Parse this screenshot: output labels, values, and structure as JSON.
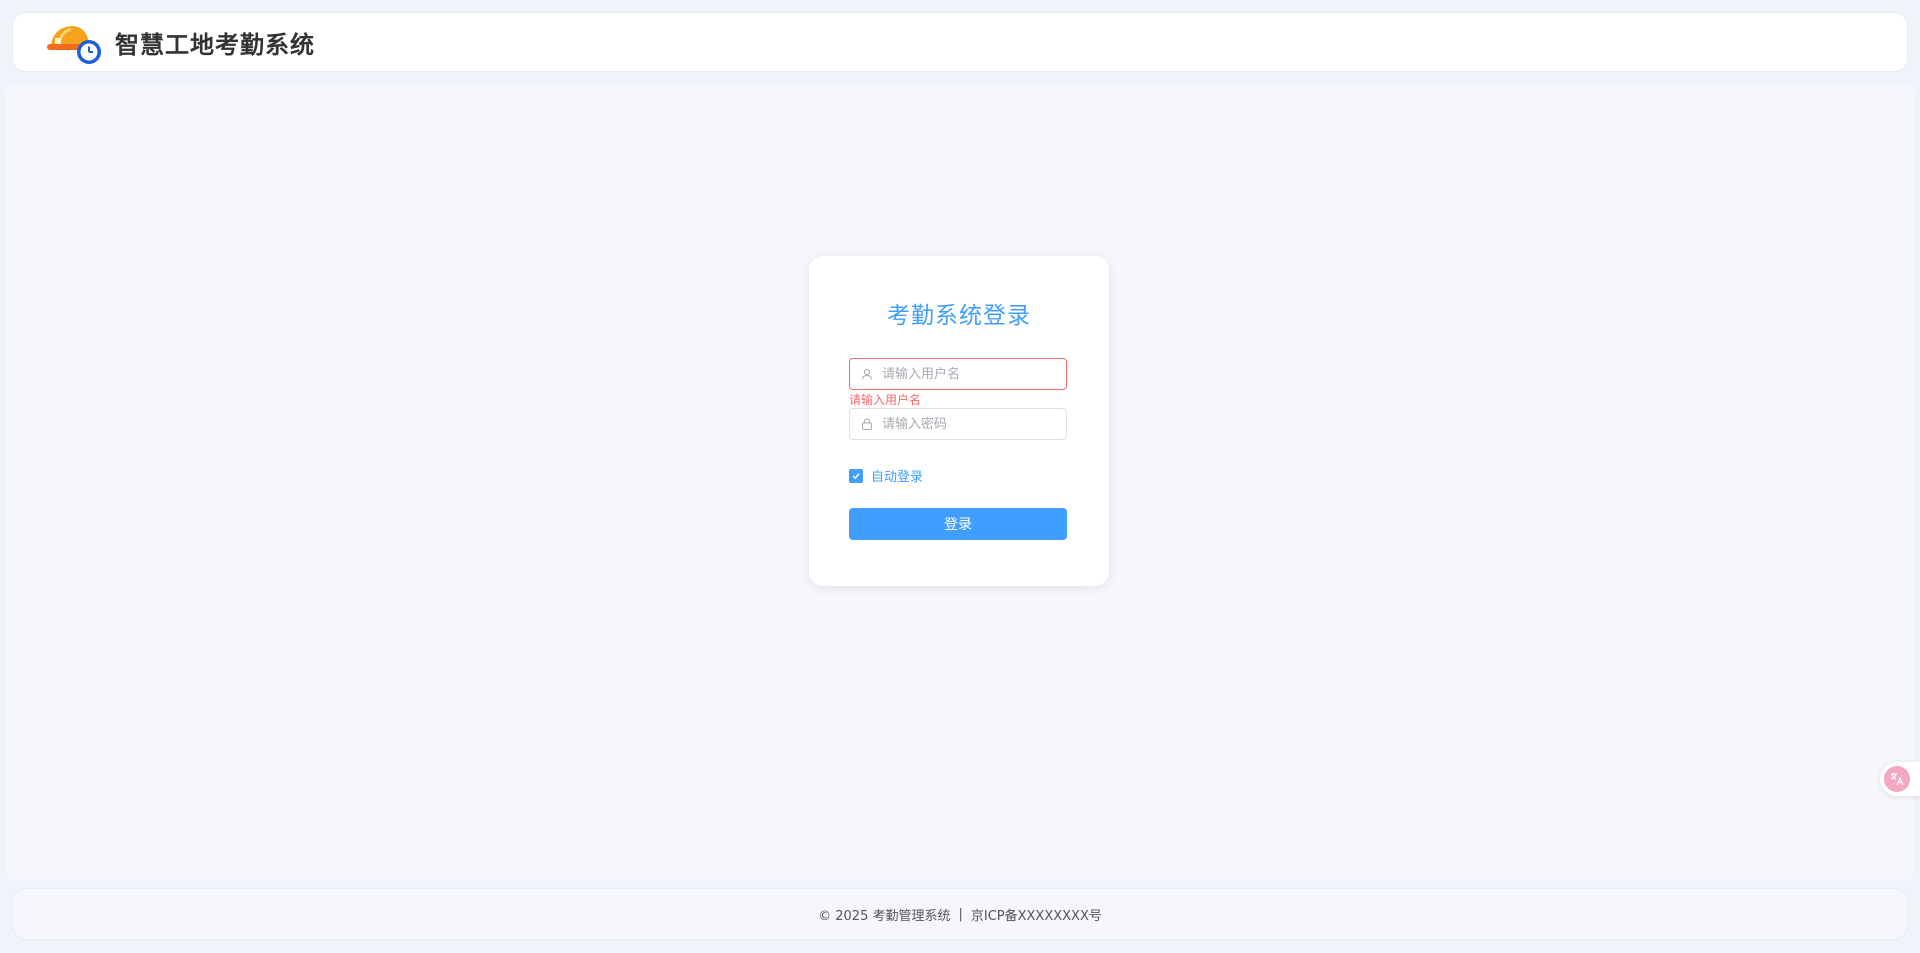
{
  "header": {
    "title": "智慧工地考勤系统",
    "logo_icon": "hardhat-clock-icon"
  },
  "login": {
    "title": "考勤系统登录",
    "username": {
      "value": "",
      "placeholder": "请输入用户名",
      "error": "请输入用户名",
      "icon": "user-icon"
    },
    "password": {
      "value": "",
      "placeholder": "请输入密码",
      "icon": "lock-icon"
    },
    "remember": {
      "label": "自动登录",
      "checked": true
    },
    "submit_label": "登录"
  },
  "footer": {
    "copyright": "© 2025 考勤管理系统",
    "separator": "|",
    "icp": "京ICP备XXXXXXXX号"
  },
  "translate_widget": {
    "icon": "translate-icon"
  },
  "colors": {
    "accent": "#409eff",
    "error": "#f56c6c",
    "background": "#f0f4fa"
  }
}
